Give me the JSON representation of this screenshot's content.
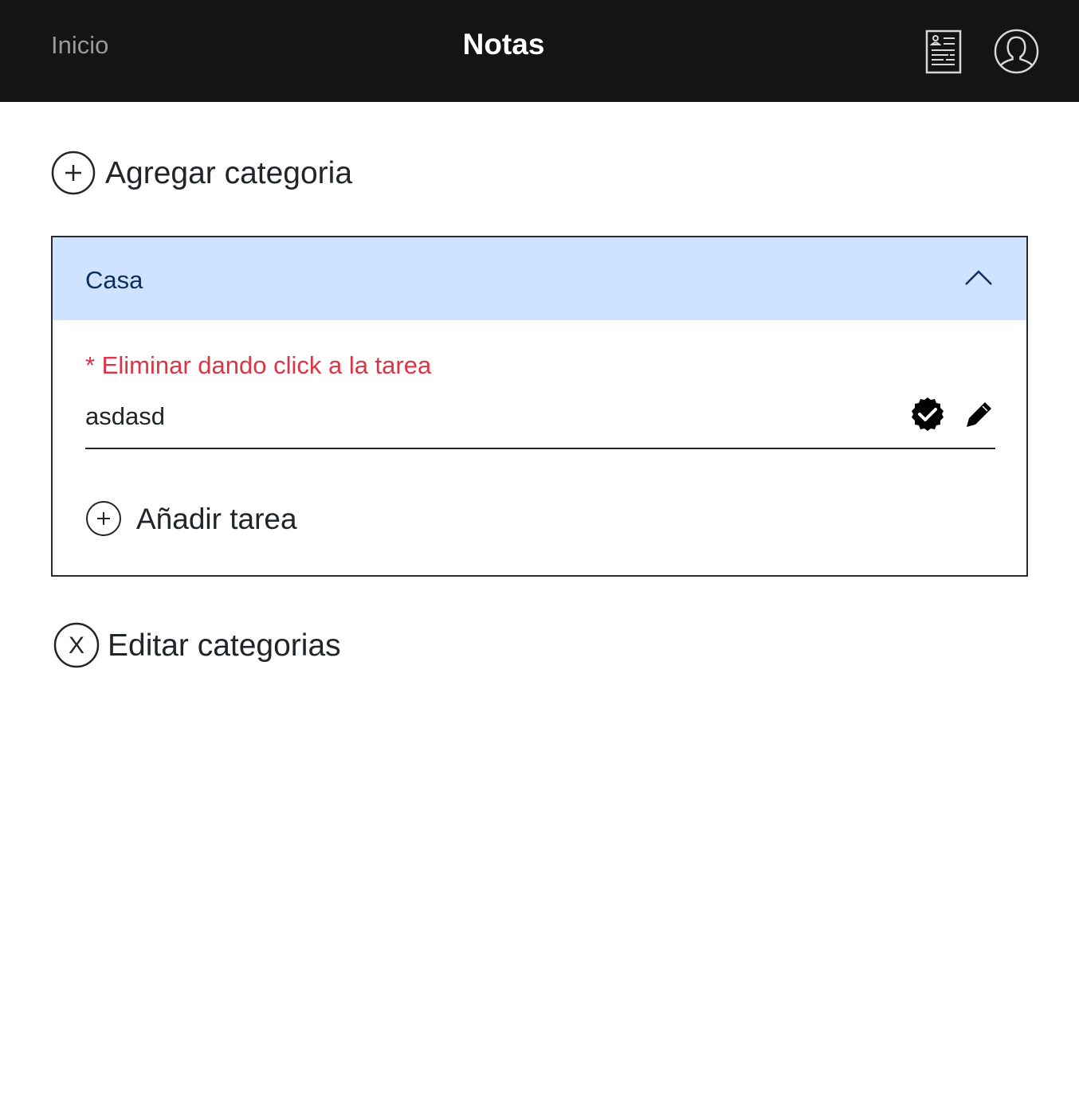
{
  "navbar": {
    "home_label": "Inicio",
    "title": "Notas",
    "notes_icon": "notes-list-icon",
    "user_icon": "user-profile-icon"
  },
  "add_category": {
    "icon": "plus-circle-icon",
    "label": "Agregar categoria"
  },
  "categories": [
    {
      "name": "Casa",
      "expanded": true,
      "hint": "* Eliminar dando click a la tarea",
      "tasks": [
        {
          "text": "asdasd",
          "icons": [
            "check-badge-icon",
            "pencil-icon"
          ]
        }
      ],
      "add_task_label": "Añadir tarea"
    }
  ],
  "edit_categories": {
    "icon": "x-circle-icon",
    "icon_glyph": "X",
    "label": "Editar categorias"
  },
  "colors": {
    "navbar_bg": "#141414",
    "nav_home": "#9a9a9a",
    "category_header_bg": "#cfe2ff",
    "category_header_text": "#0c2d5e",
    "hint_text": "#dc3545",
    "body_text": "#212529"
  }
}
